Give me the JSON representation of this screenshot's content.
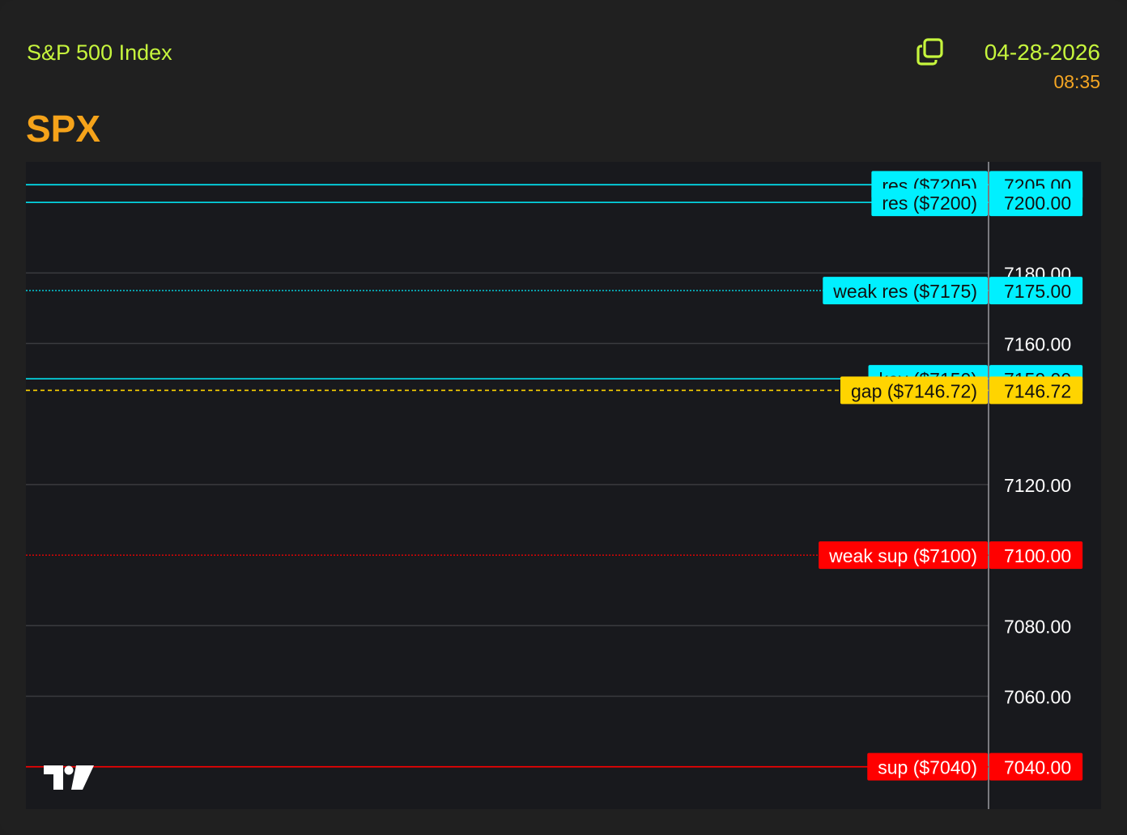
{
  "header": {
    "index_name": "S&P 500 Index",
    "date": "04-28-2026",
    "time": "08:35",
    "ticker": "SPX",
    "copy_icon": "copy-icon"
  },
  "colors": {
    "accent_green": "#c6f53d",
    "accent_orange": "#f5a31a",
    "resistance": "#00f0ff",
    "gap": "#ffd400",
    "support": "#ff0000",
    "grid": "#3a3b3f",
    "axis_text": "#ffffff"
  },
  "chart_data": {
    "type": "line",
    "ylim": [
      7028,
      7211.5
    ],
    "y_ticks": [
      "7060.00",
      "7080.00",
      "7120.00",
      "7160.00",
      "7180.00"
    ],
    "grid": true,
    "levels": [
      {
        "label": "res ($7205)",
        "price": "7205.00",
        "value": 7205,
        "kind": "resistance",
        "style": "solid"
      },
      {
        "label": "res ($7200)",
        "price": "7200.00",
        "value": 7200,
        "kind": "resistance",
        "style": "solid"
      },
      {
        "label": "weak res ($7175)",
        "price": "7175.00",
        "value": 7175,
        "kind": "resistance",
        "style": "dotted"
      },
      {
        "label": "key ($7150)",
        "price": "7150.00",
        "value": 7150,
        "kind": "resistance",
        "style": "solid"
      },
      {
        "label": "gap ($7146.72)",
        "price": "7146.72",
        "value": 7146.72,
        "kind": "gap",
        "style": "dashed"
      },
      {
        "label": "weak sup ($7100)",
        "price": "7100.00",
        "value": 7100,
        "kind": "support",
        "style": "dotted"
      },
      {
        "label": "sup ($7040)",
        "price": "7040.00",
        "value": 7040,
        "kind": "support",
        "style": "solid"
      }
    ],
    "logo": "tradingview-logo"
  }
}
